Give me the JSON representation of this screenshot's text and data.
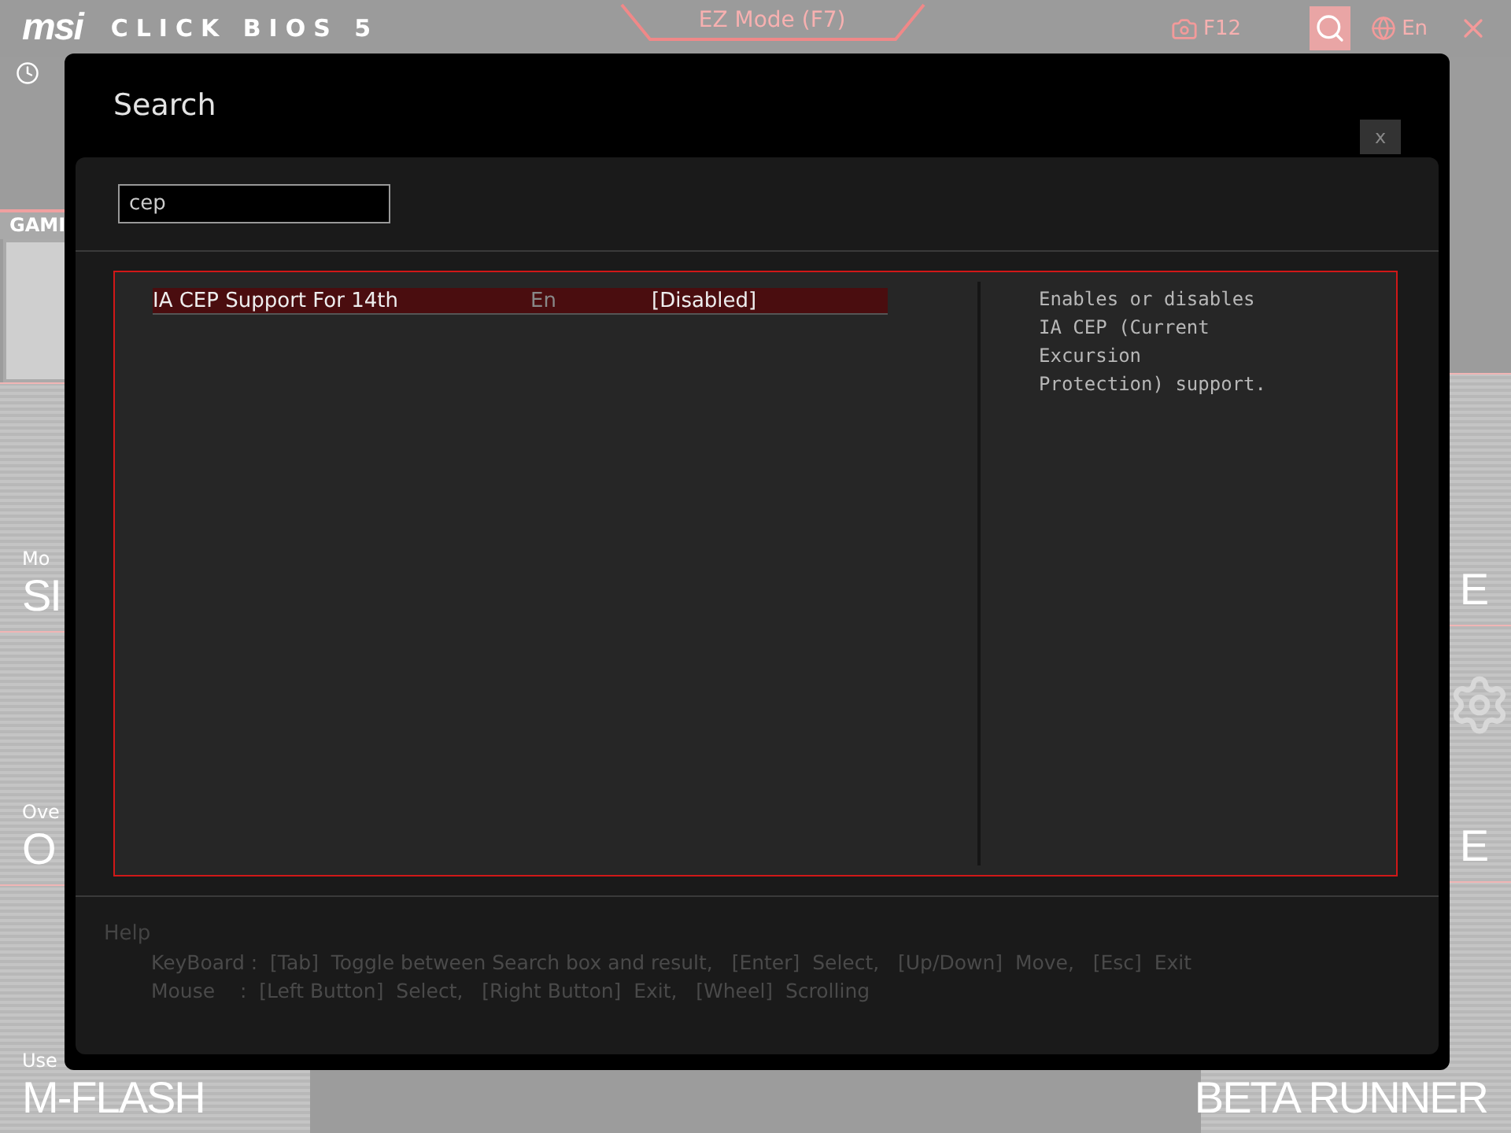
{
  "header": {
    "logo": "msi",
    "title": "CLICK BIOS 5",
    "mode_button": "EZ Mode (F7)",
    "screenshot_key": "F12",
    "search_active": true,
    "language": "En"
  },
  "background": {
    "left_tiles": [
      {
        "kind": "tab",
        "title": "GAMI"
      },
      {
        "kind": "panel"
      },
      {
        "kind": "feature",
        "caption": "Mo",
        "title": "SI"
      },
      {
        "kind": "feature",
        "caption": "Ove",
        "title": "O"
      },
      {
        "kind": "feature",
        "caption": "Use",
        "title": "M-FLASH"
      }
    ],
    "right_tiles": [
      {
        "title": "E"
      },
      {
        "title": "E"
      },
      {
        "title": "BETA RUNNER"
      }
    ]
  },
  "dialog": {
    "title": "Search",
    "close": "x",
    "query": "cep",
    "results": [
      {
        "name": "IA CEP Support For 14th",
        "language": "En",
        "value": "[Disabled]",
        "selected": true
      }
    ],
    "description": "Enables or disables IA CEP (Current Excursion Protection) support.",
    "help": {
      "title": "Help",
      "lines": [
        {
          "label": "KeyBoard :",
          "text": "[Tab]  Toggle between Search box and result,   [Enter]  Select,   [Up/Down]  Move,   [Esc]  Exit"
        },
        {
          "label": "Mouse    :",
          "text": "[Left Button]  Select,   [Right Button]  Exit,   [Wheel]  Scrolling"
        }
      ]
    }
  }
}
